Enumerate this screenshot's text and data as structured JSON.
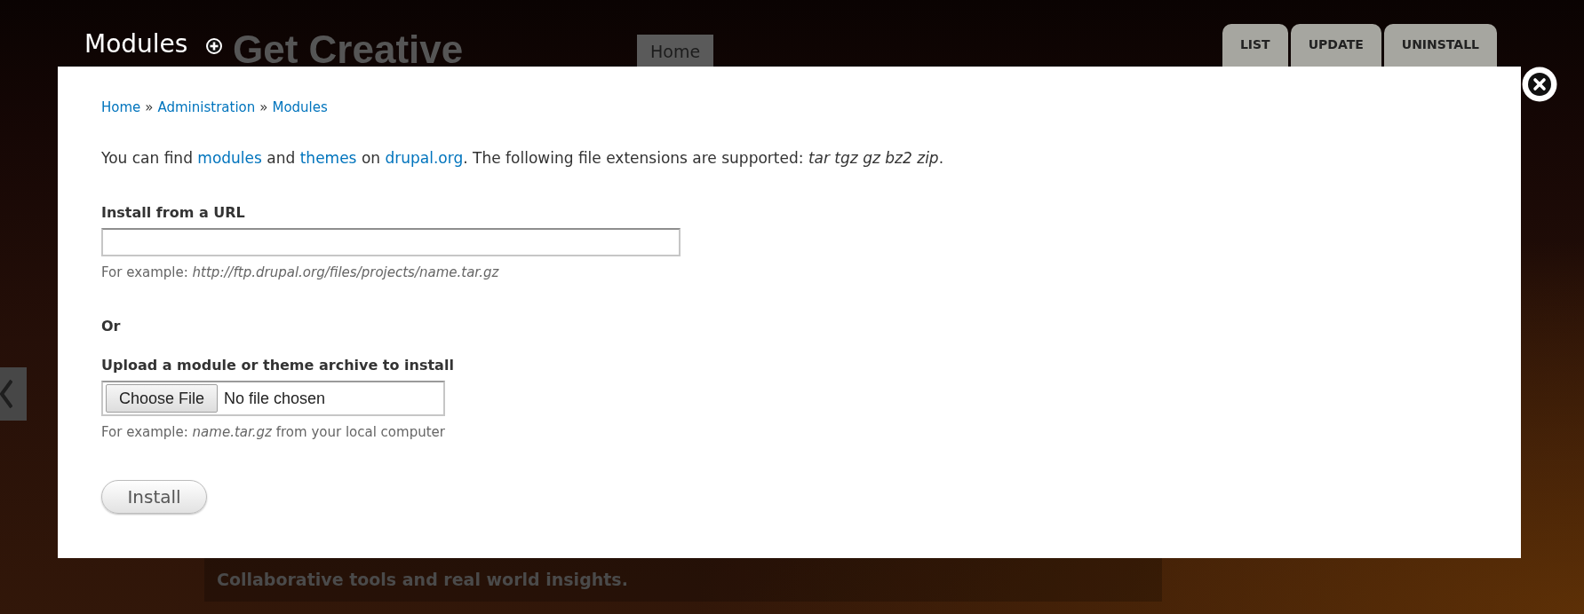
{
  "background_page": {
    "heading": "Get Creative",
    "nav_link": "Home",
    "tagline": "Collaborative tools and real world insights."
  },
  "overlay": {
    "title": "Modules",
    "tabs": [
      {
        "label": "LIST",
        "selected": false
      },
      {
        "label": "UPDATE",
        "selected": false
      },
      {
        "label": "UNINSTALL",
        "selected": false
      }
    ],
    "breadcrumb": [
      {
        "label": "Home",
        "separator": "»"
      },
      {
        "label": "Administration",
        "separator": "»"
      },
      {
        "label": "Modules"
      }
    ],
    "intro": [
      {
        "kind": "text",
        "text": "You can find "
      },
      {
        "kind": "link",
        "text": "modules"
      },
      {
        "kind": "text",
        "text": " and "
      },
      {
        "kind": "link",
        "text": "themes"
      },
      {
        "kind": "text",
        "text": " on "
      },
      {
        "kind": "link",
        "text": "drupal.org"
      },
      {
        "kind": "text",
        "text": ". The following file extensions are supported: *tar tgz gz bz2 zip*."
      }
    ],
    "url_field": {
      "label": "Install from a URL",
      "description": "For example: *http://ftp.drupal.org/files/projects/name.tar.gz*"
    },
    "or_label": "Or",
    "upload_field": {
      "label": "Upload a module or theme archive to install",
      "button": "Choose File",
      "status": "No file chosen",
      "description": "For example: *name.tar.gz* from your local computer"
    },
    "submit_button": "Install"
  }
}
